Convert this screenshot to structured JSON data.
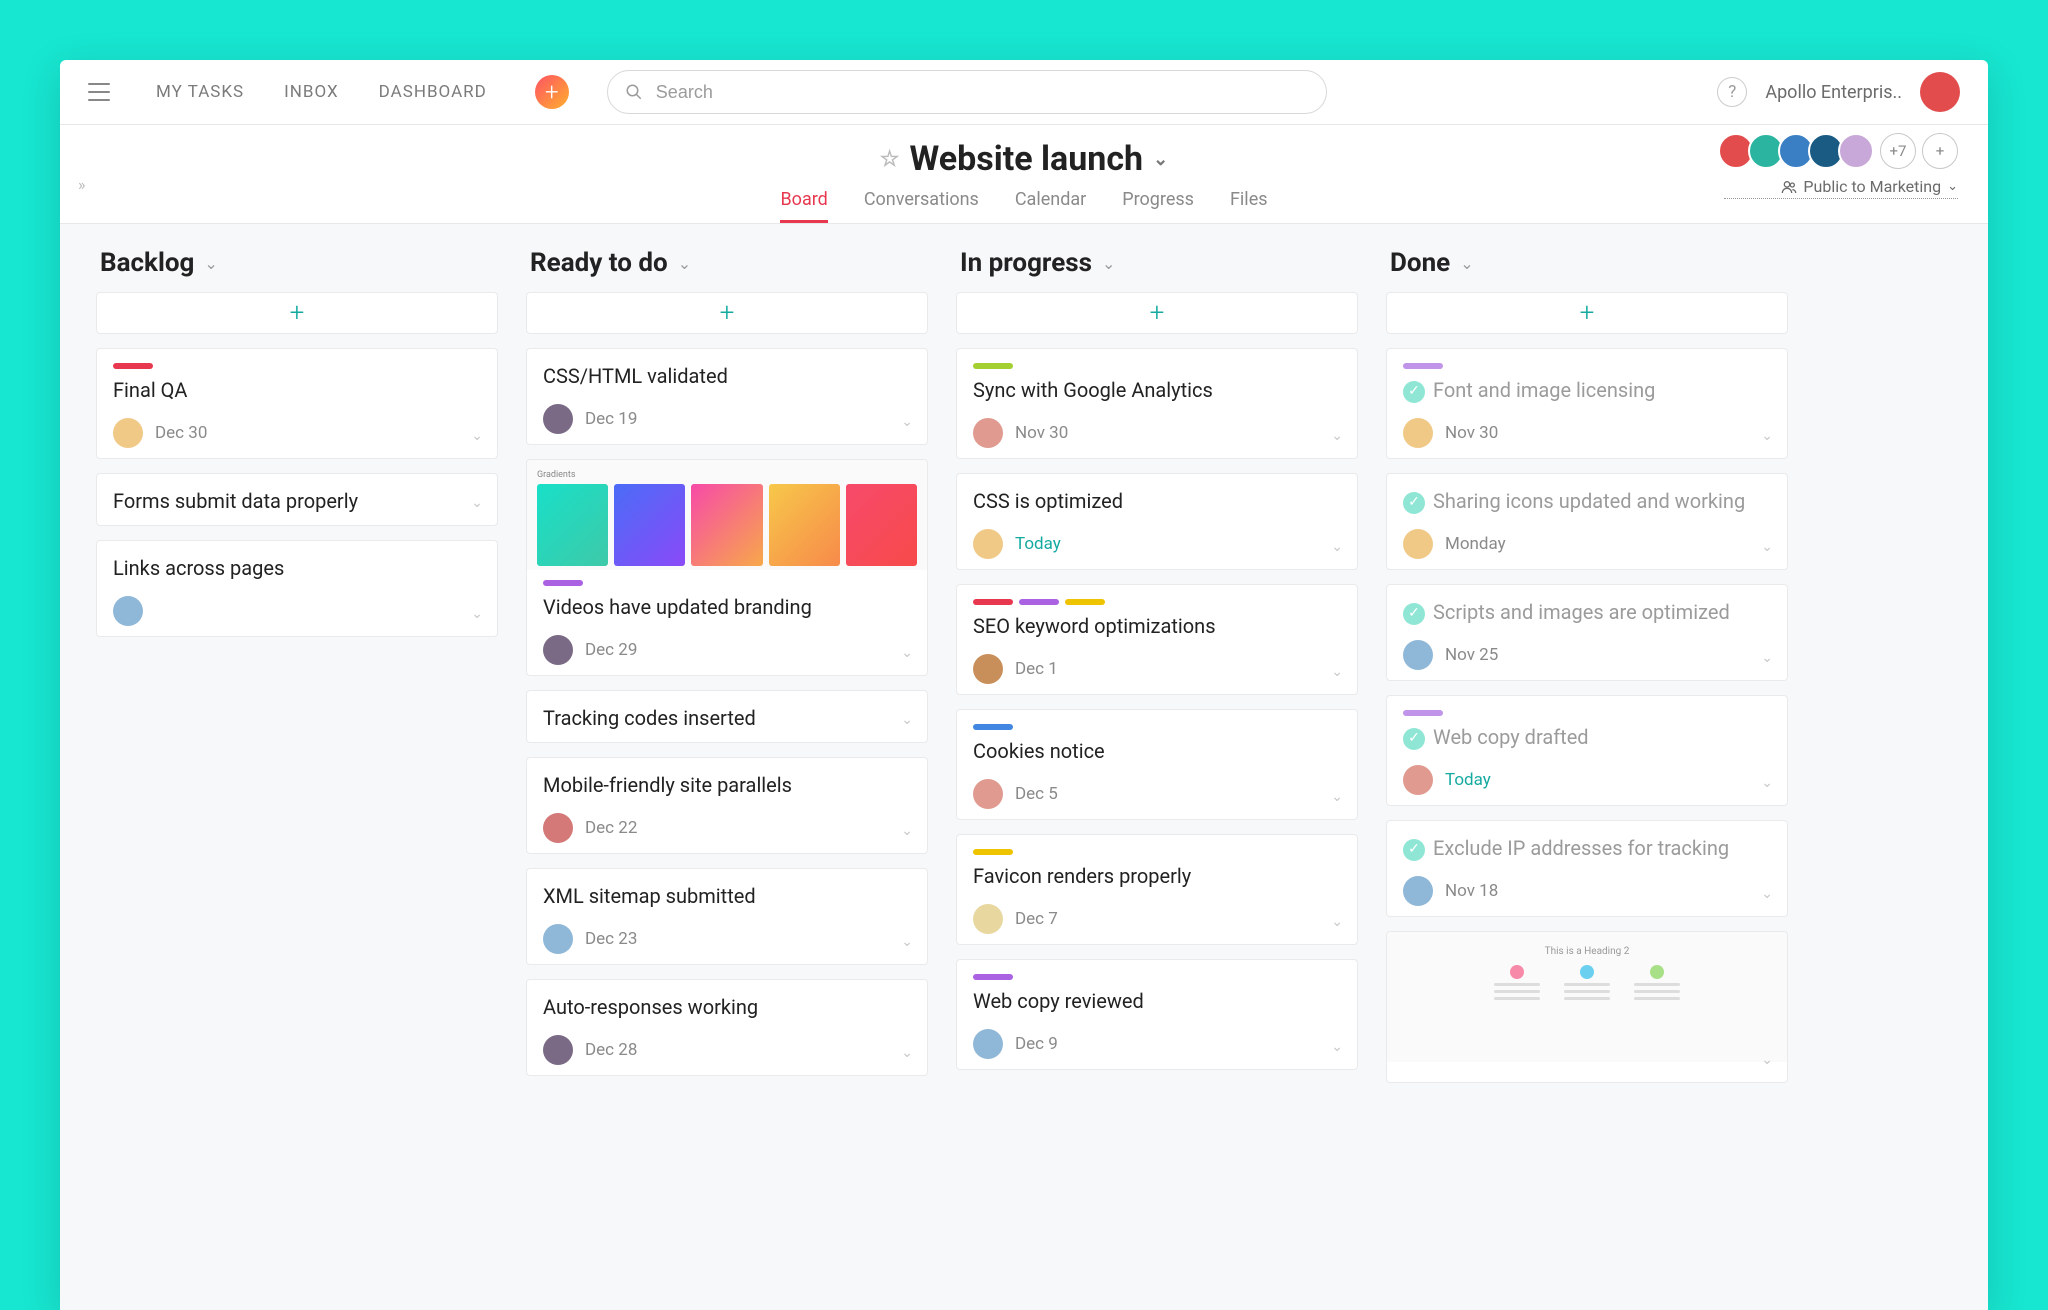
{
  "nav": {
    "my_tasks": "MY TASKS",
    "inbox": "INBOX",
    "dashboard": "DASHBOARD"
  },
  "search": {
    "placeholder": "Search"
  },
  "org": {
    "name": "Apollo Enterpris.."
  },
  "project": {
    "title": "Website launch",
    "tabs": [
      "Board",
      "Conversations",
      "Calendar",
      "Progress",
      "Files"
    ],
    "active_tab": 0,
    "more_count": "+7",
    "visibility": "Public to Marketing"
  },
  "columns": [
    {
      "name": "Backlog",
      "cards": [
        {
          "tags": [
            "t-red"
          ],
          "title": "Final QA",
          "assignee": "a1",
          "due": "Dec 30",
          "done": false
        },
        {
          "tags": [],
          "title": "Forms submit data properly",
          "assignee": null,
          "due": null,
          "done": false
        },
        {
          "tags": [],
          "title": "Links across pages",
          "assignee": "a3",
          "due": null,
          "done": false
        }
      ]
    },
    {
      "name": "Ready to do",
      "cards": [
        {
          "tags": [],
          "title": "CSS/HTML validated",
          "assignee": "a2",
          "due": "Dec 19",
          "done": false
        },
        {
          "tags": [
            "t-purple"
          ],
          "title": "Videos have updated branding",
          "assignee": "a2",
          "due": "Dec 29",
          "done": false,
          "thumb": "gradients"
        },
        {
          "tags": [],
          "title": "Tracking codes inserted",
          "assignee": null,
          "due": null,
          "done": false
        },
        {
          "tags": [],
          "title": "Mobile-friendly site parallels",
          "assignee": "a5",
          "due": "Dec 22",
          "done": false
        },
        {
          "tags": [],
          "title": "XML sitemap submitted",
          "assignee": "a3",
          "due": "Dec 23",
          "done": false
        },
        {
          "tags": [],
          "title": "Auto-responses working",
          "assignee": "a2",
          "due": "Dec 28",
          "done": false
        }
      ]
    },
    {
      "name": "In progress",
      "cards": [
        {
          "tags": [
            "t-green"
          ],
          "title": "Sync with Google Analytics",
          "assignee": "a4",
          "due": "Nov 30",
          "done": false
        },
        {
          "tags": [],
          "title": "CSS is optimized",
          "assignee": "a1",
          "due": "Today",
          "due_today": true,
          "done": false
        },
        {
          "tags": [
            "t-red",
            "t-purple",
            "t-yellow"
          ],
          "title": "SEO keyword optimizations",
          "assignee": "a6",
          "due": "Dec 1",
          "done": false
        },
        {
          "tags": [
            "t-blue"
          ],
          "title": "Cookies notice",
          "assignee": "a4",
          "due": "Dec 5",
          "done": false
        },
        {
          "tags": [
            "t-yellow"
          ],
          "title": "Favicon renders properly",
          "assignee": "a7",
          "due": "Dec 7",
          "done": false
        },
        {
          "tags": [
            "t-purple"
          ],
          "title": "Web copy reviewed",
          "assignee": "a3",
          "due": "Dec 9",
          "done": false
        }
      ]
    },
    {
      "name": "Done",
      "cards": [
        {
          "tags": [
            "t-lpurple"
          ],
          "title": "Font and image licensing",
          "assignee": "a1",
          "due": "Nov 30",
          "done": true
        },
        {
          "tags": [],
          "title": "Sharing icons updated and working",
          "assignee": "a1",
          "due": "Monday",
          "done": true
        },
        {
          "tags": [],
          "title": "Scripts and images are optimized",
          "assignee": "a3",
          "due": "Nov 25",
          "done": true
        },
        {
          "tags": [
            "t-lpurple"
          ],
          "title": "Web copy drafted",
          "assignee": "a4",
          "due": "Today",
          "due_today": true,
          "done": true
        },
        {
          "tags": [],
          "title": "Exclude IP addresses for tracking",
          "assignee": "a3",
          "due": "Nov 18",
          "done": true
        },
        {
          "tags": [],
          "title": "",
          "assignee": null,
          "due": null,
          "done": false,
          "thumb": "heading"
        }
      ]
    }
  ],
  "thumb_labels": {
    "gradients": "Gradients",
    "heading": "This is a Heading 2"
  }
}
